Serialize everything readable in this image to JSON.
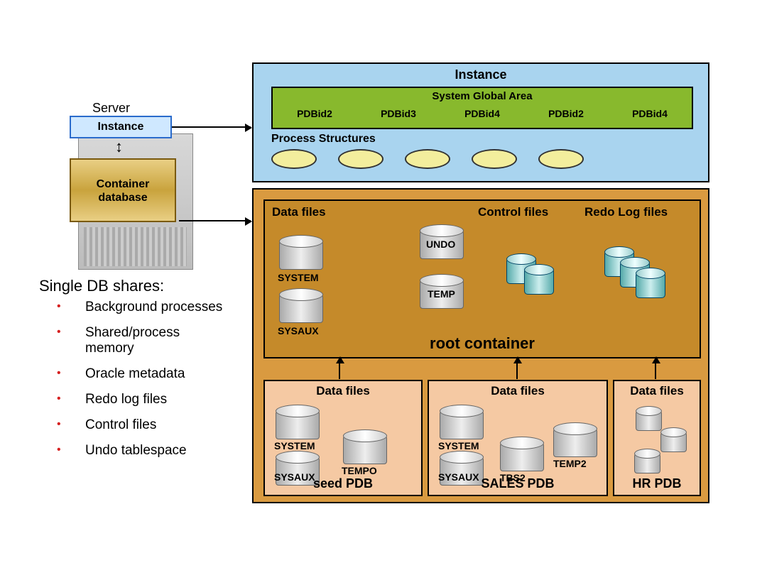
{
  "server": {
    "title": "Server",
    "instance_label": "Instance",
    "container_label": "Container database"
  },
  "shares": {
    "title": "Single DB shares:",
    "items": [
      "Background processes",
      "Shared/process memory",
      "Oracle metadata",
      "Redo log files",
      "Control files",
      "Undo tablespace"
    ]
  },
  "instance": {
    "title": "Instance",
    "sga_title": "System Global Area",
    "sga_items": [
      "PDBid2",
      "PDBid3",
      "PDBid4",
      "PDBid2",
      "PDBid4"
    ],
    "process_label": "Process Structures",
    "process_count": 5
  },
  "cdb": {
    "root": {
      "title": "root container",
      "datafiles_label": "Data files",
      "control_label": "Control files",
      "redo_label": "Redo Log files",
      "datafiles": [
        "SYSTEM",
        "SYSAUX"
      ],
      "mid_files": [
        "UNDO",
        "TEMP"
      ]
    },
    "pdbs": [
      {
        "name": "seed PDB",
        "header": "Data files",
        "files": [
          "SYSTEM",
          "SYSAUX",
          "TEMPO"
        ]
      },
      {
        "name": "SALES PDB",
        "header": "Data files",
        "files": [
          "SYSTEM",
          "SYSAUX",
          "TBS2",
          "TEMP2"
        ]
      },
      {
        "name": "HR PDB",
        "header": "Data files",
        "files": []
      }
    ]
  }
}
